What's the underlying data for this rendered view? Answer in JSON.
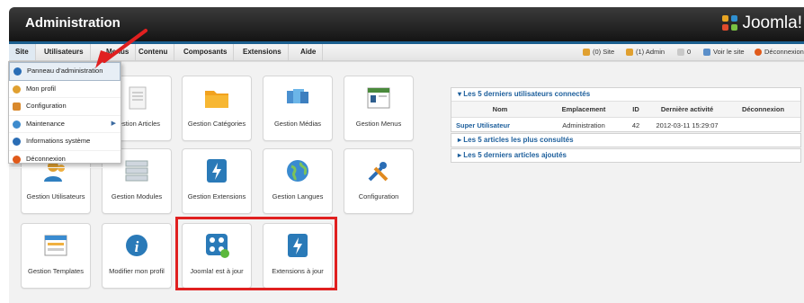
{
  "header": {
    "title": "Administration",
    "logo_text": "Joomla!"
  },
  "menu": {
    "items": [
      "Site",
      "Utilisateurs",
      "Menus",
      "Contenu",
      "Composants",
      "Extensions",
      "Aide"
    ],
    "active": "Site"
  },
  "status": {
    "site": "(0) Site",
    "admin": "(1) Admin",
    "messages": "0",
    "view_site": "Voir le site",
    "logout": "Déconnexion"
  },
  "dropdown": {
    "items": [
      {
        "label": "Panneau d'administration",
        "icon": "dashboard-icon",
        "color": "#2a6db5"
      },
      {
        "label": "Mon profil",
        "icon": "user-icon",
        "color": "#e0a030"
      },
      {
        "label": "Configuration",
        "icon": "tools-icon",
        "color": "#d9892c"
      },
      {
        "label": "Maintenance",
        "icon": "gear-icon",
        "color": "#3d8bcd"
      },
      {
        "label": "Informations système",
        "icon": "info-icon",
        "color": "#2a6db5"
      },
      {
        "label": "Déconnexion",
        "icon": "logout-icon",
        "color": "#e05a1a"
      }
    ]
  },
  "tiles": [
    {
      "label": "Gestion Articles",
      "icon": "article-icon"
    },
    {
      "label": "Gestion Catégories",
      "icon": "folder-icon"
    },
    {
      "label": "Gestion Médias",
      "icon": "media-icon"
    },
    {
      "label": "Gestion Menus",
      "icon": "menu-icon"
    },
    {
      "label": "Gestion Utilisateurs",
      "icon": "users-icon"
    },
    {
      "label": "Gestion Modules",
      "icon": "modules-icon"
    },
    {
      "label": "Gestion Extensions",
      "icon": "extension-icon"
    },
    {
      "label": "Gestion Langues",
      "icon": "globe-icon"
    },
    {
      "label": "Configuration",
      "icon": "tools-icon"
    },
    {
      "label": "Gestion Templates",
      "icon": "template-icon"
    },
    {
      "label": "Modifier mon profil",
      "icon": "info-icon"
    },
    {
      "label": "Joomla! est à jour",
      "icon": "joomla-icon"
    },
    {
      "label": "Extensions à jour",
      "icon": "extension-icon"
    }
  ],
  "panels": {
    "users": {
      "title": "Les 5 derniers utilisateurs connectés",
      "columns": [
        "Nom",
        "Emplacement",
        "ID",
        "Dernière activité",
        "Déconnexion"
      ],
      "rows": [
        [
          "Super Utilisateur",
          "Administration",
          "42",
          "2012-03-11 15:29:07",
          ""
        ]
      ]
    },
    "popular": {
      "title": "Les 5 articles les plus consultés"
    },
    "latest": {
      "title": "Les 5 derniers articles ajoutés"
    }
  },
  "colors": {
    "accent": "#1d5f9c",
    "highlight": "#e02020",
    "header": "#1f1f1f"
  }
}
